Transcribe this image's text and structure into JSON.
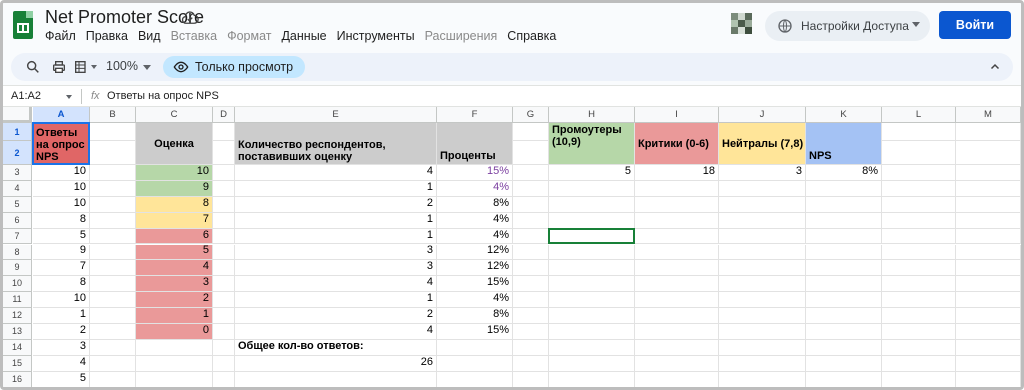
{
  "app": {
    "title": "Net Promoter Score",
    "menu": [
      {
        "label": "Файл",
        "enabled": true
      },
      {
        "label": "Правка",
        "enabled": true
      },
      {
        "label": "Вид",
        "enabled": true
      },
      {
        "label": "Вставка",
        "enabled": false
      },
      {
        "label": "Формат",
        "enabled": false
      },
      {
        "label": "Данные",
        "enabled": true
      },
      {
        "label": "Инструменты",
        "enabled": true
      },
      {
        "label": "Расширения",
        "enabled": false
      },
      {
        "label": "Справка",
        "enabled": true
      }
    ],
    "access_label": "Настройки Доступа",
    "login_label": "Войти"
  },
  "toolbar": {
    "zoom": "100%",
    "view_only_label": "Только просмотр"
  },
  "formula_bar": {
    "name_box": "A1:A2",
    "fx": "fx",
    "content": "Ответы на опрос NPS"
  },
  "columns": [
    "A",
    "B",
    "C",
    "D",
    "E",
    "F",
    "G",
    "H",
    "I",
    "J",
    "K",
    "L",
    "M"
  ],
  "rows": [
    "1",
    "2",
    "3",
    "4",
    "5",
    "6",
    "7",
    "8",
    "9",
    "10",
    "11",
    "12",
    "13",
    "14",
    "15",
    "16"
  ],
  "colors": {
    "red_header": "#e06666",
    "green": "#b6d7a8",
    "yellow": "#ffe599",
    "red_light": "#ea9999",
    "gray_header": "#cccccc",
    "blue": "#a4c2f4",
    "selection": "#1a73e8",
    "accent": "#0b57d0"
  },
  "cells": [
    {
      "col": "A",
      "row": 1,
      "rowspan": 2,
      "text": "Ответы на опрос NPS",
      "bold": true,
      "bg": "#e06666",
      "align": "left",
      "wrap": true
    },
    {
      "col": "C",
      "row": 1,
      "rowspan": 2,
      "text": "Оценка",
      "bold": true,
      "bg": "#cccccc",
      "align": "center",
      "valign": "middle"
    },
    {
      "col": "E",
      "row": 1,
      "rowspan": 2,
      "text": "Количество респондентов, поставивших оценку",
      "bold": true,
      "bg": "#cccccc",
      "align": "left",
      "valign": "bottom",
      "wrap": true
    },
    {
      "col": "F",
      "row": 1,
      "rowspan": 2,
      "text": "Проценты",
      "bold": true,
      "bg": "#cccccc",
      "align": "left",
      "valign": "bottom"
    },
    {
      "col": "H",
      "row": 1,
      "rowspan": 2,
      "text": "Промоутеры (10,9)",
      "bold": true,
      "bg": "#b6d7a8",
      "align": "left",
      "valign": "top",
      "wrap": true
    },
    {
      "col": "I",
      "row": 1,
      "rowspan": 2,
      "text": "Критики (0-6)",
      "bold": true,
      "bg": "#ea9999",
      "align": "left",
      "valign": "middle"
    },
    {
      "col": "J",
      "row": 1,
      "rowspan": 2,
      "text": "Нейтралы (7,8)",
      "bold": true,
      "bg": "#ffe599",
      "align": "left",
      "valign": "middle"
    },
    {
      "col": "K",
      "row": 1,
      "rowspan": 2,
      "text": "NPS",
      "bold": true,
      "bg": "#a4c2f4",
      "align": "left",
      "valign": "bottom"
    },
    {
      "col": "A",
      "row": 3,
      "text": "10",
      "align": "right"
    },
    {
      "col": "A",
      "row": 4,
      "text": "10",
      "align": "right"
    },
    {
      "col": "A",
      "row": 5,
      "text": "10",
      "align": "right"
    },
    {
      "col": "A",
      "row": 6,
      "text": "8",
      "align": "right"
    },
    {
      "col": "A",
      "row": 7,
      "text": "5",
      "align": "right"
    },
    {
      "col": "A",
      "row": 8,
      "text": "9",
      "align": "right"
    },
    {
      "col": "A",
      "row": 9,
      "text": "7",
      "align": "right"
    },
    {
      "col": "A",
      "row": 10,
      "text": "8",
      "align": "right"
    },
    {
      "col": "A",
      "row": 11,
      "text": "10",
      "align": "right"
    },
    {
      "col": "A",
      "row": 12,
      "text": "1",
      "align": "right"
    },
    {
      "col": "A",
      "row": 13,
      "text": "2",
      "align": "right"
    },
    {
      "col": "A",
      "row": 14,
      "text": "3",
      "align": "right"
    },
    {
      "col": "A",
      "row": 15,
      "text": "4",
      "align": "right"
    },
    {
      "col": "A",
      "row": 16,
      "text": "5",
      "align": "right"
    },
    {
      "col": "C",
      "row": 3,
      "text": "10",
      "align": "right",
      "bg": "#b6d7a8"
    },
    {
      "col": "C",
      "row": 4,
      "text": "9",
      "align": "right",
      "bg": "#b6d7a8"
    },
    {
      "col": "C",
      "row": 5,
      "text": "8",
      "align": "right",
      "bg": "#ffe599"
    },
    {
      "col": "C",
      "row": 6,
      "text": "7",
      "align": "right",
      "bg": "#ffe599"
    },
    {
      "col": "C",
      "row": 7,
      "text": "6",
      "align": "right",
      "bg": "#ea9999"
    },
    {
      "col": "C",
      "row": 8,
      "text": "5",
      "align": "right",
      "bg": "#ea9999"
    },
    {
      "col": "C",
      "row": 9,
      "text": "4",
      "align": "right",
      "bg": "#ea9999"
    },
    {
      "col": "C",
      "row": 10,
      "text": "3",
      "align": "right",
      "bg": "#ea9999"
    },
    {
      "col": "C",
      "row": 11,
      "text": "2",
      "align": "right",
      "bg": "#ea9999"
    },
    {
      "col": "C",
      "row": 12,
      "text": "1",
      "align": "right",
      "bg": "#ea9999"
    },
    {
      "col": "C",
      "row": 13,
      "text": "0",
      "align": "right",
      "bg": "#ea9999"
    },
    {
      "col": "E",
      "row": 3,
      "text": "4",
      "align": "right"
    },
    {
      "col": "E",
      "row": 4,
      "text": "1",
      "align": "right"
    },
    {
      "col": "E",
      "row": 5,
      "text": "2",
      "align": "right"
    },
    {
      "col": "E",
      "row": 6,
      "text": "1",
      "align": "right"
    },
    {
      "col": "E",
      "row": 7,
      "text": "1",
      "align": "right"
    },
    {
      "col": "E",
      "row": 8,
      "text": "3",
      "align": "right"
    },
    {
      "col": "E",
      "row": 9,
      "text": "3",
      "align": "right"
    },
    {
      "col": "E",
      "row": 10,
      "text": "4",
      "align": "right"
    },
    {
      "col": "E",
      "row": 11,
      "text": "1",
      "align": "right"
    },
    {
      "col": "E",
      "row": 12,
      "text": "2",
      "align": "right"
    },
    {
      "col": "E",
      "row": 13,
      "text": "4",
      "align": "right"
    },
    {
      "col": "E",
      "row": 14,
      "text": "Общее кол-во ответов:",
      "bold": true,
      "align": "left"
    },
    {
      "col": "E",
      "row": 15,
      "text": "26",
      "align": "right"
    },
    {
      "col": "F",
      "row": 3,
      "text": "15%",
      "align": "right",
      "color": "#7b3fa0"
    },
    {
      "col": "F",
      "row": 4,
      "text": "4%",
      "align": "right",
      "color": "#7b3fa0"
    },
    {
      "col": "F",
      "row": 5,
      "text": "8%",
      "align": "right"
    },
    {
      "col": "F",
      "row": 6,
      "text": "4%",
      "align": "right"
    },
    {
      "col": "F",
      "row": 7,
      "text": "4%",
      "align": "right"
    },
    {
      "col": "F",
      "row": 8,
      "text": "12%",
      "align": "right"
    },
    {
      "col": "F",
      "row": 9,
      "text": "12%",
      "align": "right"
    },
    {
      "col": "F",
      "row": 10,
      "text": "15%",
      "align": "right"
    },
    {
      "col": "F",
      "row": 11,
      "text": "4%",
      "align": "right"
    },
    {
      "col": "F",
      "row": 12,
      "text": "8%",
      "align": "right"
    },
    {
      "col": "F",
      "row": 13,
      "text": "15%",
      "align": "right"
    },
    {
      "col": "H",
      "row": 3,
      "text": "5",
      "align": "right"
    },
    {
      "col": "I",
      "row": 3,
      "text": "18",
      "align": "right"
    },
    {
      "col": "J",
      "row": 3,
      "text": "3",
      "align": "right"
    },
    {
      "col": "K",
      "row": 3,
      "text": "8%",
      "align": "right"
    }
  ]
}
